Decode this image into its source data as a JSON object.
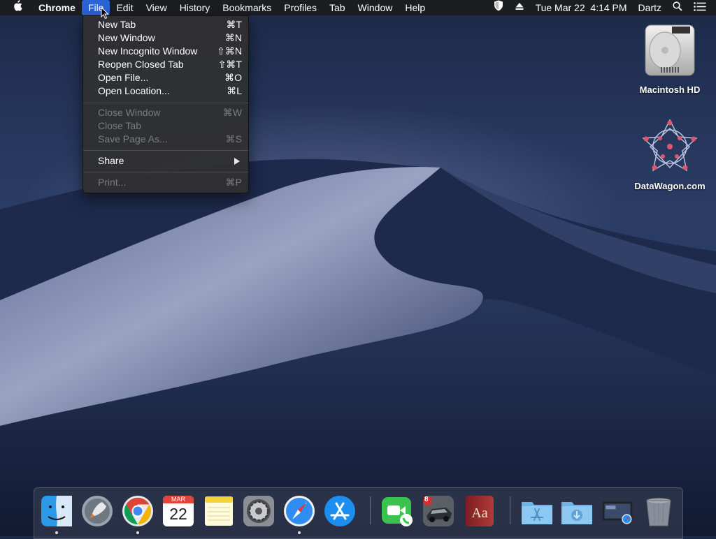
{
  "menubar": {
    "app_name": "Chrome",
    "menus": [
      "File",
      "Edit",
      "View",
      "History",
      "Bookmarks",
      "Profiles",
      "Tab",
      "Window",
      "Help"
    ],
    "active_menu": "File",
    "clock": "Tue Mar 22  4:14 PM",
    "user": "Dartz",
    "icons": [
      "apple-icon",
      "shield-icon",
      "eject-icon",
      "search-icon",
      "list-icon"
    ]
  },
  "file_menu": {
    "group1": [
      {
        "label": "New Tab",
        "shortcut": "⌘T"
      },
      {
        "label": "New Window",
        "shortcut": "⌘N"
      },
      {
        "label": "New Incognito Window",
        "shortcut": "⇧⌘N"
      },
      {
        "label": "Reopen Closed Tab",
        "shortcut": "⇧⌘T"
      },
      {
        "label": "Open File...",
        "shortcut": "⌘O"
      },
      {
        "label": "Open Location...",
        "shortcut": "⌘L"
      }
    ],
    "group2": [
      {
        "label": "Close Window",
        "shortcut": "⌘W",
        "disabled": true
      },
      {
        "label": "Close Tab",
        "shortcut": "",
        "disabled": true
      },
      {
        "label": "Save Page As...",
        "shortcut": "⌘S",
        "disabled": true
      }
    ],
    "share": {
      "label": "Share"
    },
    "print": {
      "label": "Print...",
      "shortcut": "⌘P",
      "disabled": true
    }
  },
  "desktop_icons": [
    {
      "label": "Macintosh HD",
      "icon": "hard-drive-icon"
    },
    {
      "label": "DataWagon.com",
      "icon": "network-globe-icon"
    }
  ],
  "dock": {
    "apps": [
      "finder-icon",
      "launchpad-icon",
      "chrome-icon",
      "calendar-icon",
      "notes-icon",
      "system-preferences-icon",
      "safari-icon",
      "app-store-icon",
      "facetime-icon",
      "racing-game-icon",
      "dictionary-icon",
      "applications-folder-icon",
      "downloads-folder-icon",
      "screenshot-safari-icon",
      "trash-icon"
    ],
    "calendar_month": "MAR",
    "calendar_day": "22",
    "dictionary_text": "Aa",
    "badge_text": "8"
  }
}
